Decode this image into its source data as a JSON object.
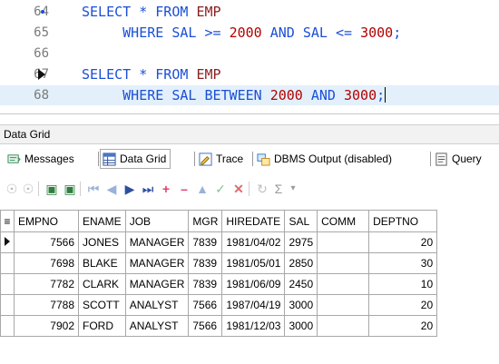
{
  "editor": {
    "lines": [
      {
        "num": "64",
        "tokens": [
          [
            "kw",
            "SELECT * FROM "
          ],
          [
            "id",
            "EMP"
          ]
        ]
      },
      {
        "num": "65",
        "tokens": [
          [
            "kw",
            "     WHERE SAL >= "
          ],
          [
            "num",
            "2000"
          ],
          [
            "kw",
            " AND SAL <= "
          ],
          [
            "num",
            "3000"
          ],
          [
            "kw",
            ";"
          ]
        ]
      },
      {
        "num": "66",
        "tokens": []
      },
      {
        "num": "67",
        "tokens": [
          [
            "kw",
            "SELECT * FROM "
          ],
          [
            "id",
            "EMP"
          ]
        ]
      },
      {
        "num": "68",
        "tokens": [
          [
            "kw",
            "     WHERE SAL BETWEEN "
          ],
          [
            "num",
            "2000"
          ],
          [
            "kw",
            " AND "
          ],
          [
            "num",
            "3000"
          ],
          [
            "kw",
            ";"
          ]
        ]
      }
    ]
  },
  "panel": {
    "title": "Data Grid"
  },
  "tabs": [
    {
      "label": "Messages",
      "icon": "messages-icon"
    },
    {
      "label": "Data Grid",
      "icon": "data-grid-icon"
    },
    {
      "label": "Trace",
      "icon": "trace-icon"
    },
    {
      "label": "DBMS Output (disabled)",
      "icon": "dbms-output-icon"
    },
    {
      "label": "Query",
      "icon": "query-icon"
    }
  ],
  "toolbar_icons": [
    "copy-icon",
    "paste-icon",
    "export-icon",
    "import-icon",
    "first-record-icon",
    "prev-record-icon",
    "next-record-icon",
    "last-record-icon",
    "add-record-icon",
    "delete-record-icon",
    "move-up-icon",
    "post-edit-icon",
    "cancel-edit-icon",
    "refresh-icon",
    "sum-icon",
    "dropdown-icon"
  ],
  "grid": {
    "columns": [
      "EMPNO",
      "ENAME",
      "JOB",
      "MGR",
      "HIREDATE",
      "SAL",
      "COMM",
      "DEPTNO"
    ],
    "rows": [
      [
        "7566",
        "JONES",
        "MANAGER",
        "7839",
        "1981/04/02",
        "2975",
        "",
        "20"
      ],
      [
        "7698",
        "BLAKE",
        "MANAGER",
        "7839",
        "1981/05/01",
        "2850",
        "",
        "30"
      ],
      [
        "7782",
        "CLARK",
        "MANAGER",
        "7839",
        "1981/06/09",
        "2450",
        "",
        "10"
      ],
      [
        "7788",
        "SCOTT",
        "ANALYST",
        "7566",
        "1987/04/19",
        "3000",
        "",
        "20"
      ],
      [
        "7902",
        "FORD",
        "ANALYST",
        "7566",
        "1981/12/03",
        "3000",
        "",
        "20"
      ]
    ]
  }
}
